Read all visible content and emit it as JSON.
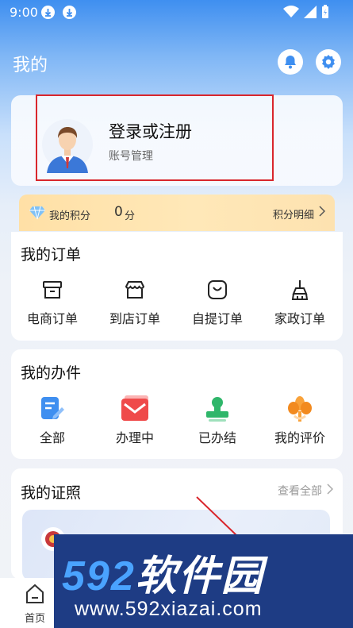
{
  "status_bar": {
    "time": "9:00"
  },
  "header": {
    "title": "我的",
    "notification_icon": "bell-icon",
    "settings_icon": "gear-icon"
  },
  "profile": {
    "login_label": "登录或注册",
    "account_label": "账号管理"
  },
  "points": {
    "label": "我的积分",
    "value": "0",
    "unit": "分",
    "detail_label": "积分明细"
  },
  "orders": {
    "title": "我的订单",
    "items": [
      {
        "label": "电商订单",
        "icon": "archive-box-icon"
      },
      {
        "label": "到店订单",
        "icon": "storefront-icon"
      },
      {
        "label": "自提订单",
        "icon": "shopping-bag-icon"
      },
      {
        "label": "家政订单",
        "icon": "broom-icon"
      }
    ]
  },
  "affairs": {
    "title": "我的办件",
    "items": [
      {
        "label": "全部",
        "icon": "document-edit-icon"
      },
      {
        "label": "办理中",
        "icon": "mail-icon"
      },
      {
        "label": "已办结",
        "icon": "stamp-icon"
      },
      {
        "label": "我的评价",
        "icon": "flower-icon"
      }
    ]
  },
  "certificates": {
    "title": "我的证照",
    "view_all": "查看全部"
  },
  "bottom_nav": {
    "home_label": "首页"
  },
  "watermark": {
    "brand_num": "592",
    "brand_text": "软件园",
    "url": "www.592xiazai.com"
  },
  "colors": {
    "primary": "#3f8ff0",
    "highlight": "#d9262c",
    "points_bg": "#ffe4ad",
    "watermark_bg": "#1e3c84"
  }
}
